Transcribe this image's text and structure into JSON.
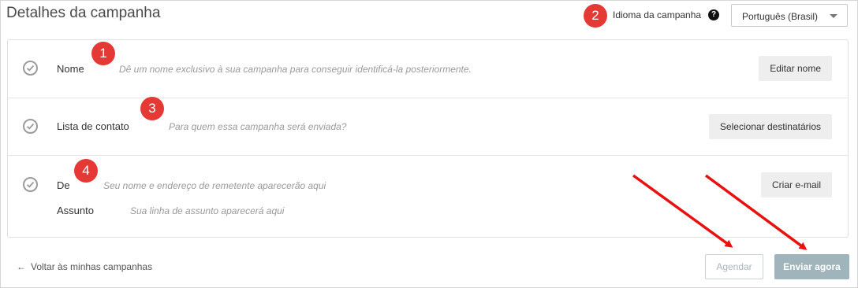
{
  "header": {
    "title": "Detalhes da campanha",
    "language_label": "Idioma da campanha",
    "help_icon": "question-circle-icon",
    "language_select": {
      "value": "Português (Brasil)"
    }
  },
  "annotations": {
    "badges": [
      "1",
      "2",
      "3",
      "4"
    ],
    "color": "#e53935",
    "arrow_color": "#e8110f"
  },
  "rows": {
    "name": {
      "label": "Nome",
      "hint": "Dê um nome exclusivo à sua campanha para conseguir identificá-la posteriormente.",
      "button": "Editar nome"
    },
    "contacts": {
      "label": "Lista de contato",
      "hint": "Para quem essa campanha será enviada?",
      "button": "Selecionar destinatários"
    },
    "sender": {
      "label": "De",
      "hint": "Seu nome e endereço de remetente aparecerão aqui",
      "subject_label": "Assunto",
      "subject_hint": "Sua linha de assunto aparecerá aqui",
      "button": "Criar e-mail"
    }
  },
  "footer": {
    "back_arrow": "←",
    "back_link": "Voltar às minhas campanhas",
    "schedule_button": "Agendar",
    "send_button": "Enviar agora"
  }
}
